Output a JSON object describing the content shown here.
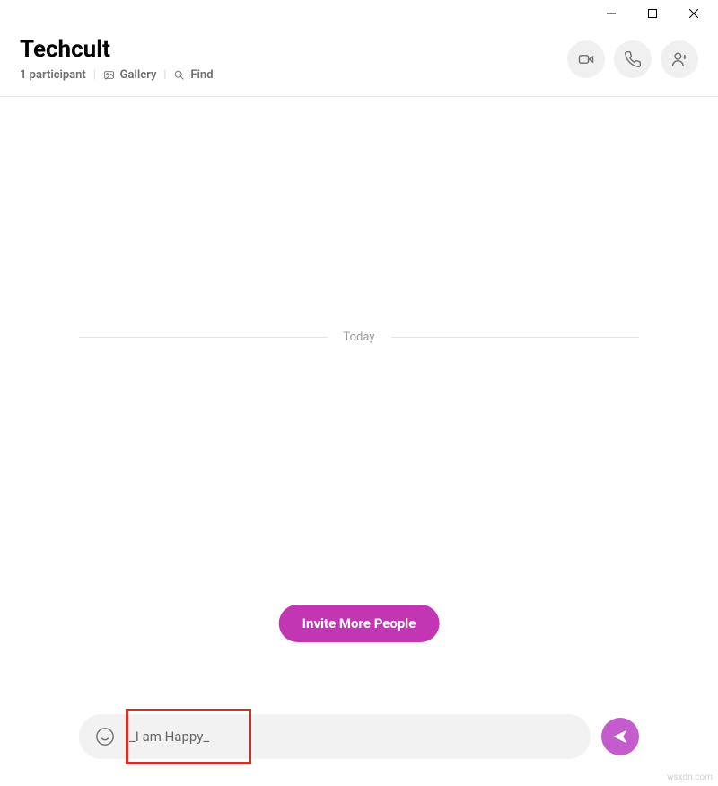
{
  "header": {
    "title": "Techcult",
    "participants": "1 participant",
    "gallery": "Gallery",
    "find": "Find"
  },
  "divider": {
    "label": "Today"
  },
  "invite": {
    "label": "Invite More People"
  },
  "composer": {
    "value": "_I am Happy_"
  },
  "watermark": "wsxdn.com"
}
